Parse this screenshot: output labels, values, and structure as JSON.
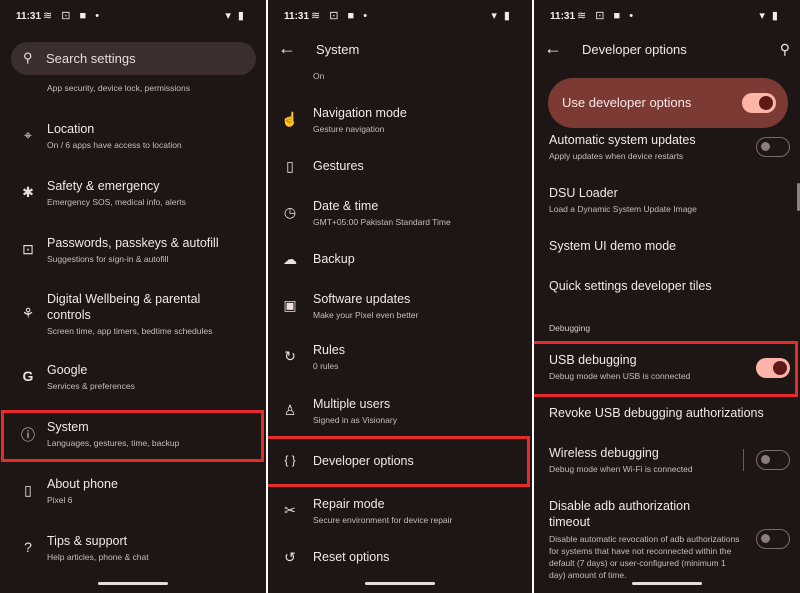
{
  "status": {
    "time": "11:31",
    "icons": "≋ ⊡ ■ •",
    "right": "▾ ▮"
  },
  "panel1": {
    "search_placeholder": "Search settings",
    "top_sub": "App security, device lock, permissions",
    "items": [
      {
        "title": "Location",
        "sub": "On / 6 apps have access to location",
        "icon": "location-pin-icon",
        "glyph": "⌖"
      },
      {
        "title": "Safety & emergency",
        "sub": "Emergency SOS, medical info, alerts",
        "icon": "asterisk-icon",
        "glyph": "✱"
      },
      {
        "title": "Passwords, passkeys & autofill",
        "sub": "Suggestions for sign-in & autofill",
        "icon": "account-box-icon",
        "glyph": "⊡"
      },
      {
        "title": "Digital Wellbeing & parental controls",
        "sub": "Screen time, app timers, bedtime schedules",
        "icon": "wellbeing-icon",
        "glyph": "⚘"
      },
      {
        "title": "Google",
        "sub": "Services & preferences",
        "icon": "google-icon",
        "glyph": "G"
      },
      {
        "title": "System",
        "sub": "Languages, gestures, time, backup",
        "icon": "info-icon",
        "glyph": "ⓘ"
      },
      {
        "title": "About phone",
        "sub": "Pixel 6",
        "icon": "phone-icon",
        "glyph": "▯"
      },
      {
        "title": "Tips & support",
        "sub": "Help articles, phone & chat",
        "icon": "help-icon",
        "glyph": "?"
      }
    ]
  },
  "panel2": {
    "title": "System",
    "top_sub": "On",
    "items": [
      {
        "title": "Navigation mode",
        "sub": "Gesture navigation",
        "icon": "gesture-icon",
        "glyph": "☝"
      },
      {
        "title": "Gestures",
        "sub": "",
        "icon": "phone-gesture-icon",
        "glyph": "▯"
      },
      {
        "title": "Date & time",
        "sub": "GMT+05:00 Pakistan Standard Time",
        "icon": "clock-icon",
        "glyph": "◷"
      },
      {
        "title": "Backup",
        "sub": "",
        "icon": "cloud-icon",
        "glyph": "☁"
      },
      {
        "title": "Software updates",
        "sub": "Make your Pixel even better",
        "icon": "update-icon",
        "glyph": "▣"
      },
      {
        "title": "Rules",
        "sub": "0 rules",
        "icon": "rules-icon",
        "glyph": "↻"
      },
      {
        "title": "Multiple users",
        "sub": "Signed in as Visionary",
        "icon": "person-icon",
        "glyph": "♙"
      },
      {
        "title": "Developer options",
        "sub": "",
        "icon": "braces-icon",
        "glyph": "{ }"
      },
      {
        "title": "Repair mode",
        "sub": "Secure environment for device repair",
        "icon": "tools-icon",
        "glyph": "✂"
      },
      {
        "title": "Reset options",
        "sub": "",
        "icon": "history-icon",
        "glyph": "↺"
      }
    ]
  },
  "panel3": {
    "title": "Developer options",
    "use_dev_label": "Use developer options",
    "section_debugging": "Debugging",
    "items": [
      {
        "title": "Automatic system updates",
        "sub": "Apply updates when device restarts",
        "toggle": "off"
      },
      {
        "title": "DSU Loader",
        "sub": "Load a Dynamic System Update Image"
      },
      {
        "title": "System UI demo mode",
        "sub": ""
      },
      {
        "title": "Quick settings developer tiles",
        "sub": ""
      },
      {
        "title": "USB debugging",
        "sub": "Debug mode when USB is connected",
        "toggle": "on"
      },
      {
        "title": "Revoke USB debugging authorizations",
        "sub": ""
      },
      {
        "title": "Wireless debugging",
        "sub": "Debug mode when Wi-Fi is connected",
        "toggle": "off"
      },
      {
        "title": "Disable adb authorization timeout",
        "sub": "Disable automatic revocation of adb authorizations for systems that have not reconnected within the default (7 days) or user-configured (minimum 1 day) amount of time.",
        "toggle": "off"
      }
    ]
  },
  "colors": {
    "background": "#1d1614",
    "highlight": "#e52b2b",
    "toggle_on": "#ffb4a9",
    "dev_card": "#7c3a34"
  }
}
